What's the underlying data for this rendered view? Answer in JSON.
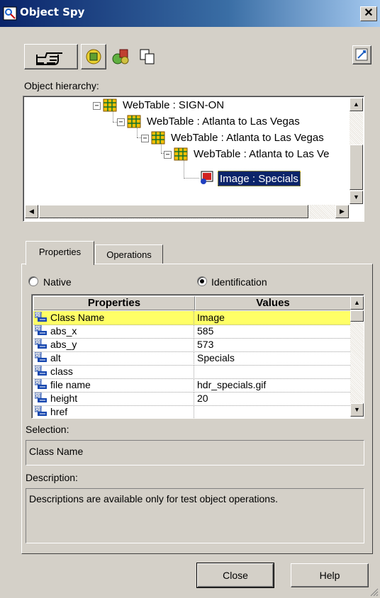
{
  "window": {
    "title": "Object Spy",
    "close_glyph": "✕"
  },
  "toolbar": {
    "icons": [
      "pointing-hand-icon",
      "object-icon",
      "objects-icon",
      "copy-icon",
      "highlight-icon"
    ]
  },
  "hierarchy": {
    "label": "Object hierarchy:",
    "nodes": [
      {
        "text": "WebTable : SIGN-ON",
        "expander": "−"
      },
      {
        "text": "WebTable : Atlanta to Las Vegas",
        "expander": "−"
      },
      {
        "text": "WebTable : Atlanta to Las Vegas",
        "expander": "−"
      },
      {
        "text": "WebTable : Atlanta to Las Ve",
        "expander": "−"
      },
      {
        "text": "Image : Specials",
        "selected": true
      }
    ]
  },
  "tabs": [
    {
      "label": "Properties",
      "active": true
    },
    {
      "label": "Operations",
      "active": false
    }
  ],
  "mode": {
    "native_label": "Native",
    "identification_label": "Identification",
    "selected": "Identification"
  },
  "grid": {
    "headers": {
      "properties": "Properties",
      "values": "Values"
    },
    "rows": [
      {
        "name": "Class Name",
        "value": "Image",
        "selected": true
      },
      {
        "name": "abs_x",
        "value": "585"
      },
      {
        "name": "abs_y",
        "value": "573"
      },
      {
        "name": "alt",
        "value": "Specials"
      },
      {
        "name": "class",
        "value": ""
      },
      {
        "name": "file name",
        "value": "hdr_specials.gif"
      },
      {
        "name": "height",
        "value": "20"
      },
      {
        "name": "href",
        "value": ""
      }
    ]
  },
  "selection": {
    "label": "Selection:",
    "value": "Class Name"
  },
  "description": {
    "label": "Description:",
    "value": "Descriptions are available only for test object operations."
  },
  "buttons": {
    "close": "Close",
    "help": "Help"
  },
  "colors": {
    "selection_bg": "#0a246a",
    "row_highlight": "#ffff66",
    "titlebar": "#0a246a"
  }
}
